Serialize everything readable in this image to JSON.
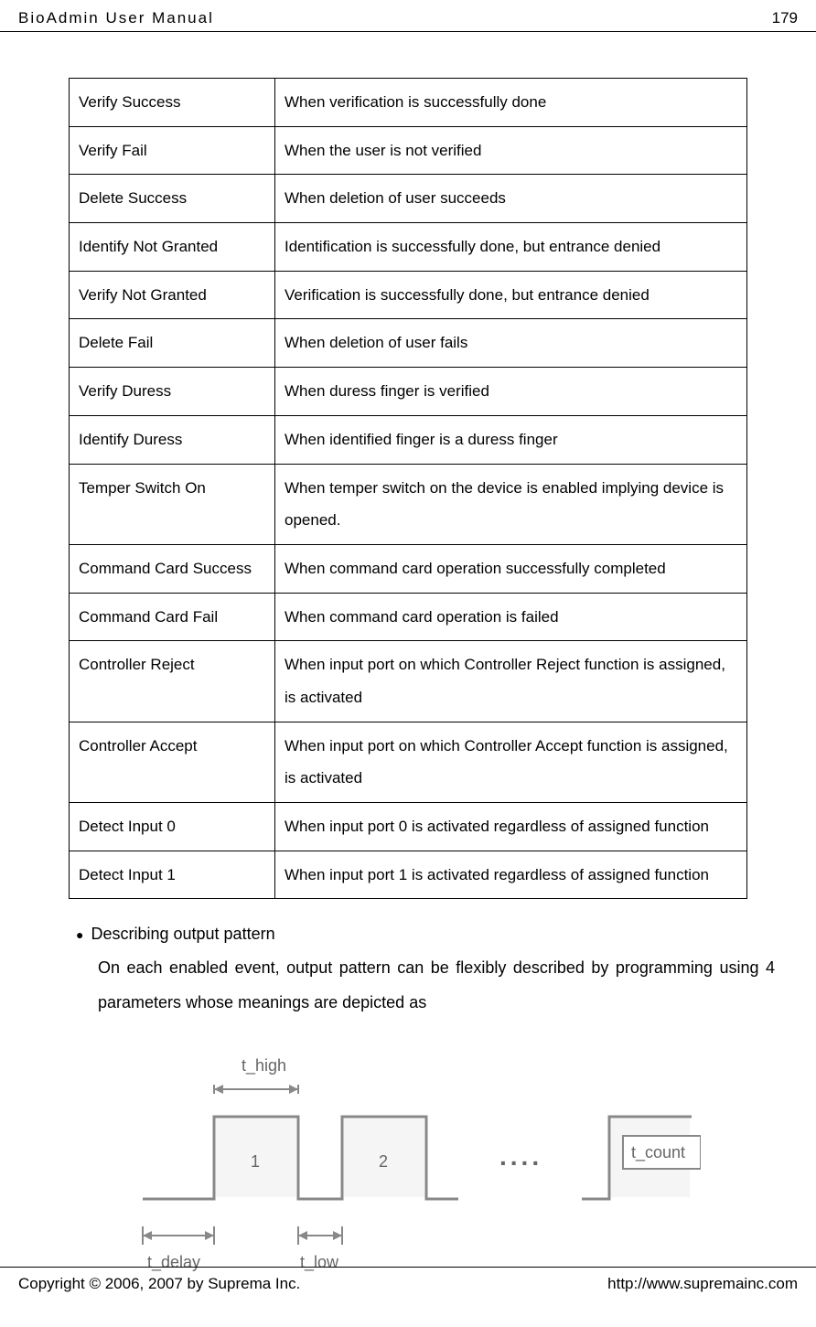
{
  "header": {
    "title": "BioAdmin User Manual",
    "page": "179"
  },
  "table": {
    "rows": [
      {
        "event": "Verify Success",
        "desc": "When verification is successfully done"
      },
      {
        "event": "Verify Fail",
        "desc": "When the user is not verified"
      },
      {
        "event": "Delete Success",
        "desc": "When deletion of user succeeds"
      },
      {
        "event": "Identify Not Granted",
        "desc": "Identification is successfully done, but entrance denied"
      },
      {
        "event": "Verify Not Granted",
        "desc": "Verification is successfully done, but entrance denied"
      },
      {
        "event": "Delete Fail",
        "desc": "When deletion of user fails"
      },
      {
        "event": "Verify Duress",
        "desc": "When duress finger is verified"
      },
      {
        "event": "Identify Duress",
        "desc": "When identified finger is a duress finger"
      },
      {
        "event": "Temper Switch On",
        "desc": "When temper switch on the device is enabled implying device is opened."
      },
      {
        "event": "Command Card Success",
        "desc": "When command card operation successfully completed"
      },
      {
        "event": "Command Card Fail",
        "desc": "When command card operation is failed"
      },
      {
        "event": "Controller Reject",
        "desc": "When input port on which Controller Reject function is assigned, is activated"
      },
      {
        "event": "Controller Accept",
        "desc": "When input port on which Controller Accept function is assigned, is activated"
      },
      {
        "event": "Detect Input 0",
        "desc": "When input port 0 is activated regardless of assigned function"
      },
      {
        "event": "Detect Input 1",
        "desc": "When input port 1 is activated regardless of assigned function"
      }
    ]
  },
  "section": {
    "bullet_title": "Describing output pattern",
    "description": "On each enabled event, output pattern can be flexibly described by programming using 4 parameters whose meanings are depicted as"
  },
  "diagram": {
    "t_high": "t_high",
    "t_delay": "t_delay",
    "t_low": "t_low",
    "t_count": "t_count",
    "pulse1": "1",
    "pulse2": "2",
    "dots": "...."
  },
  "footer": {
    "copyright": "Copyright © 2006, 2007 by Suprema Inc.",
    "url": "http://www.supremainc.com"
  }
}
